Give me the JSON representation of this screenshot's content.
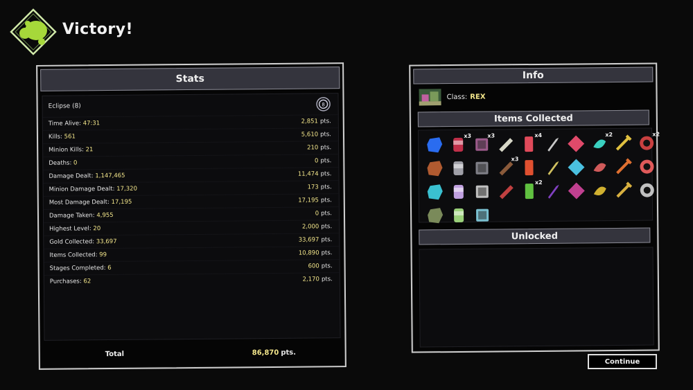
{
  "header": {
    "title": "Victory!"
  },
  "stats": {
    "title": "Stats",
    "difficulty": "Eclipse (8)",
    "rows": [
      {
        "label": "Time Alive:",
        "value": "47:31",
        "pts": "2,851",
        "suffix": "pts."
      },
      {
        "label": "Kills:",
        "value": "561",
        "pts": "5,610",
        "suffix": "pts."
      },
      {
        "label": "Minion Kills:",
        "value": "21",
        "pts": "210",
        "suffix": "pts."
      },
      {
        "label": "Deaths:",
        "value": "0",
        "pts": "0",
        "suffix": "pts."
      },
      {
        "label": "Damage Dealt:",
        "value": "1,147,465",
        "pts": "11,474",
        "suffix": "pts."
      },
      {
        "label": "Minion Damage Dealt:",
        "value": "17,320",
        "pts": "173",
        "suffix": "pts."
      },
      {
        "label": "Most Damage Dealt:",
        "value": "17,195",
        "pts": "17,195",
        "suffix": "pts."
      },
      {
        "label": "Damage Taken:",
        "value": "4,955",
        "pts": "0",
        "suffix": "pts."
      },
      {
        "label": "Highest Level:",
        "value": "20",
        "pts": "2,000",
        "suffix": "pts."
      },
      {
        "label": "Gold Collected:",
        "value": "33,697",
        "pts": "33,697",
        "suffix": "pts."
      },
      {
        "label": "Items Collected:",
        "value": "99",
        "pts": "10,890",
        "suffix": "pts."
      },
      {
        "label": "Stages Completed:",
        "value": "6",
        "pts": "600",
        "suffix": "pts."
      },
      {
        "label": "Purchases:",
        "value": "62",
        "pts": "2,170",
        "suffix": "pts."
      }
    ],
    "total_label": "Total",
    "total_value": "86,870",
    "total_suffix": "pts."
  },
  "info": {
    "title": "Info",
    "class_label": "Class:",
    "class_value": "REX",
    "items_title": "Items Collected",
    "unlocked_title": "Unlocked",
    "items": [
      {
        "icon": "blue-crystal-icon",
        "color": "#2a6cf0",
        "count": ""
      },
      {
        "icon": "soda-can-icon",
        "color": "#c0304a",
        "count": "x3"
      },
      {
        "icon": "tome-icon",
        "color": "#9b5a8a",
        "count": "x3"
      },
      {
        "icon": "bandage-icon",
        "color": "#d8d8c8",
        "count": ""
      },
      {
        "icon": "energy-drink-icon",
        "color": "#e04a5a",
        "count": "x4"
      },
      {
        "icon": "crowbar-icon",
        "color": "#c8c8c8",
        "count": ""
      },
      {
        "icon": "red-crystal-icon",
        "color": "#e04a6a",
        "count": ""
      },
      {
        "icon": "hook-icon",
        "color": "#3ad0c0",
        "count": "x2"
      },
      {
        "icon": "syringe-icon",
        "color": "#e0c040",
        "count": ""
      },
      {
        "icon": "glasses-icon",
        "color": "#c84040",
        "count": "x2"
      },
      {
        "icon": "claw-icon",
        "color": "#b05a30",
        "count": ""
      },
      {
        "icon": "armor-plate-icon",
        "color": "#a0a0a8",
        "count": ""
      },
      {
        "icon": "boot-icon",
        "color": "#808088",
        "count": ""
      },
      {
        "icon": "teddy-bear-icon",
        "color": "#8a5a3a",
        "count": "x3"
      },
      {
        "icon": "spinner-icon",
        "color": "#e05030",
        "count": ""
      },
      {
        "icon": "tri-tip-dagger-icon",
        "color": "#d0c060",
        "count": ""
      },
      {
        "icon": "bug-icon",
        "color": "#4ac0e0",
        "count": ""
      },
      {
        "icon": "steak-icon",
        "color": "#d05a5a",
        "count": ""
      },
      {
        "icon": "rocket-icon",
        "color": "#e07030",
        "count": ""
      },
      {
        "icon": "chain-icon",
        "color": "#e05a5a",
        "count": ""
      },
      {
        "icon": "horn-icon",
        "color": "#3ac0d0",
        "count": ""
      },
      {
        "icon": "vial-icon",
        "color": "#c0a0e0",
        "count": ""
      },
      {
        "icon": "battery-icon",
        "color": "#c0c0c0",
        "count": ""
      },
      {
        "icon": "leaf-icon",
        "color": "#c04040",
        "count": ""
      },
      {
        "icon": "fire-box-icon",
        "color": "#60c040",
        "count": "x2"
      },
      {
        "icon": "void-egg-icon",
        "color": "#8040c0",
        "count": ""
      },
      {
        "icon": "brain-icon",
        "color": "#c04090",
        "count": ""
      },
      {
        "icon": "golden-egg-icon",
        "color": "#d0b030",
        "count": ""
      },
      {
        "icon": "gold-shield-icon",
        "color": "#d8b040",
        "count": ""
      },
      {
        "icon": "necklace-icon",
        "color": "#c0c0c0",
        "count": ""
      },
      {
        "icon": "hammer-icon",
        "color": "#7a8a5a",
        "count": ""
      },
      {
        "icon": "jar-icon",
        "color": "#9ad07a",
        "count": ""
      },
      {
        "icon": "chain-link-icon",
        "color": "#7ac0d0",
        "count": ""
      }
    ]
  },
  "footer": {
    "continue_label": "Continue"
  }
}
